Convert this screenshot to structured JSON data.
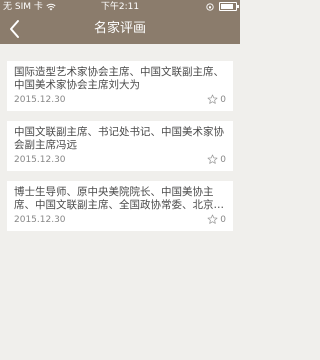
{
  "status_bar": {
    "carrier": "无 SIM 卡",
    "time": "下午2:11"
  },
  "nav": {
    "title": "名家评画"
  },
  "items": [
    {
      "text": "国际造型艺术家协会主席、中国文联副主席、中国美术家协会主席刘大为",
      "date": "2015.12.30",
      "likes": "0"
    },
    {
      "text": "中国文联副主席、书记处书记、中国美术家协会副主席冯远",
      "date": "2015.12.30",
      "likes": "0"
    },
    {
      "text": "博士生导师、原中央美院院长、中国美协主席、中国文联副主席、全国政协常委、北京市政协副主席靳尚谊",
      "date": "2015.12.30",
      "likes": "0"
    }
  ],
  "colors": {
    "header": "#8b7c6c",
    "background": "#f0efec",
    "card": "#ffffff"
  }
}
